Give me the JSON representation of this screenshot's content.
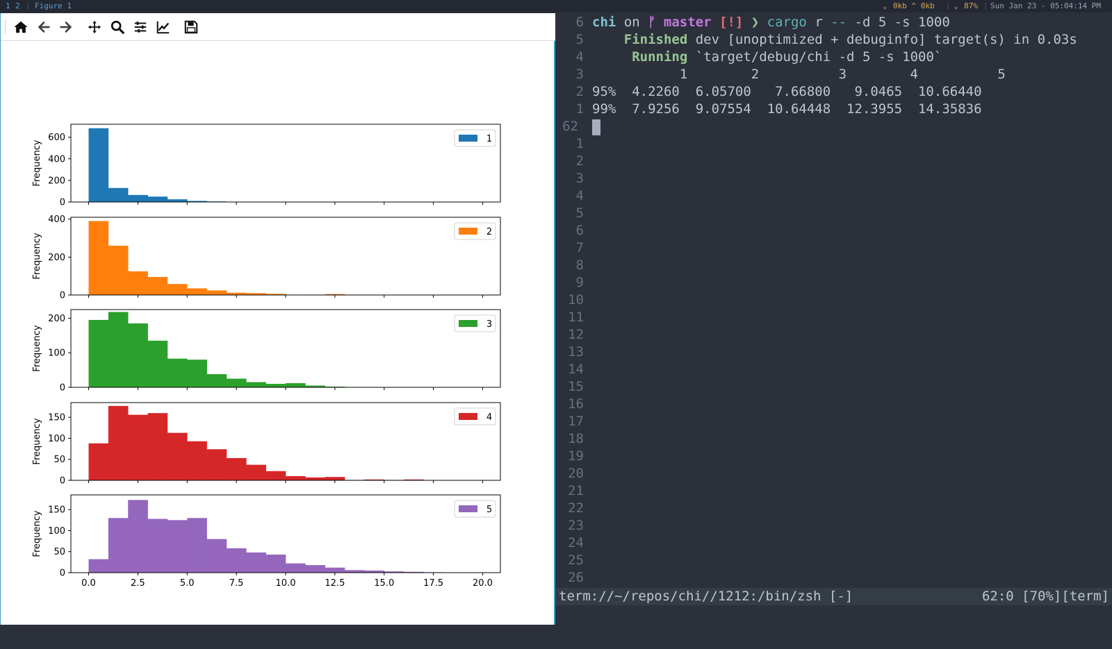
{
  "topbar": {
    "workspaces": [
      "1",
      "2"
    ],
    "window_title": "Figure 1",
    "net": "0kb ^ 0kb",
    "battery": "87%",
    "datetime": "Sun Jan 23 - 05:04:14 PM"
  },
  "figure_window": {
    "toolbar_tools": [
      {
        "name": "home-icon",
        "tooltip": "Home"
      },
      {
        "name": "back-icon",
        "tooltip": "Back"
      },
      {
        "name": "forward-icon",
        "tooltip": "Forward"
      },
      {
        "name": "pan-icon",
        "tooltip": "Pan"
      },
      {
        "name": "zoom-icon",
        "tooltip": "Zoom"
      },
      {
        "name": "configure-subplots-icon",
        "tooltip": "Subplots"
      },
      {
        "name": "edit-axes-icon",
        "tooltip": "Customize"
      },
      {
        "name": "save-icon",
        "tooltip": "Save"
      }
    ]
  },
  "chart_data": {
    "type": "bar",
    "layout": "5 stacked histogram subplots sharing x axis",
    "ylabel": "Frequency",
    "bin_start": 0,
    "bin_width": 1,
    "xlim": [
      -0.9,
      20.9
    ],
    "xticks": [
      "0.0",
      "2.5",
      "5.0",
      "7.5",
      "10.0",
      "12.5",
      "15.0",
      "17.5",
      "20.0"
    ],
    "xtick_values": [
      0,
      2.5,
      5,
      7.5,
      10,
      12.5,
      15,
      17.5,
      20
    ],
    "legend_placement": "top-right",
    "series": [
      {
        "name": "1",
        "color": "#1f77b4",
        "ylim": [
          0,
          720
        ],
        "yticks": [
          "0",
          "200",
          "400",
          "600"
        ],
        "ytick_values": [
          0,
          200,
          400,
          600
        ],
        "values": [
          683,
          130,
          65,
          50,
          25,
          10,
          5,
          3,
          2,
          1,
          0,
          0,
          0,
          0,
          0,
          0,
          0,
          0,
          0,
          0
        ]
      },
      {
        "name": "2",
        "color": "#ff7f0e",
        "ylim": [
          0,
          410
        ],
        "yticks": [
          "0",
          "200",
          "400"
        ],
        "ytick_values": [
          0,
          200,
          400
        ],
        "values": [
          390,
          260,
          125,
          95,
          58,
          35,
          24,
          12,
          10,
          6,
          2,
          1,
          5,
          1,
          0,
          0,
          0,
          0,
          0,
          0
        ]
      },
      {
        "name": "3",
        "color": "#2ca02c",
        "ylim": [
          0,
          225
        ],
        "yticks": [
          "0",
          "100",
          "200"
        ],
        "ytick_values": [
          0,
          100,
          200
        ],
        "values": [
          195,
          218,
          185,
          135,
          83,
          80,
          38,
          25,
          15,
          10,
          12,
          5,
          2,
          0,
          0,
          0,
          0,
          0,
          0,
          0
        ]
      },
      {
        "name": "4",
        "color": "#d62728",
        "ylim": [
          0,
          185
        ],
        "yticks": [
          "0",
          "50",
          "100",
          "150"
        ],
        "ytick_values": [
          0,
          50,
          100,
          150
        ],
        "values": [
          88,
          177,
          156,
          160,
          113,
          93,
          74,
          53,
          37,
          22,
          10,
          7,
          8,
          1,
          2,
          1,
          2,
          0,
          0,
          0
        ]
      },
      {
        "name": "5",
        "color": "#9467bd",
        "ylim": [
          0,
          185
        ],
        "yticks": [
          "0",
          "50",
          "100",
          "150"
        ],
        "ytick_values": [
          0,
          50,
          100,
          150
        ],
        "values": [
          32,
          130,
          173,
          128,
          125,
          130,
          80,
          58,
          48,
          43,
          22,
          18,
          12,
          6,
          5,
          3,
          2,
          1,
          0,
          0
        ]
      }
    ]
  },
  "terminal": {
    "lines": [
      {
        "num": "6",
        "parts": [
          [
            "c-cyan",
            "chi"
          ],
          [
            "c-white",
            " on "
          ],
          [
            "c-purple",
            "ᚠ master "
          ],
          [
            "c-red",
            "[!]"
          ],
          [
            "c-green",
            " ❯ "
          ],
          [
            "c-teal",
            "cargo "
          ],
          [
            "c-white",
            "r "
          ],
          [
            "c-teal",
            "-- "
          ],
          [
            "c-white",
            "-d 5 -s 1000"
          ]
        ]
      },
      {
        "num": "5",
        "parts": [
          [
            "c-green",
            "    Finished"
          ],
          [
            "c-white",
            " dev [unoptimized + debuginfo] target(s) in 0.03s"
          ]
        ]
      },
      {
        "num": "4",
        "parts": [
          [
            "c-green",
            "     Running"
          ],
          [
            "c-white",
            " `target/debug/chi -d 5 -s 1000`"
          ]
        ]
      },
      {
        "num": "3",
        "parts": [
          [
            "c-white",
            "           1        2          3        4          5"
          ]
        ]
      },
      {
        "num": "2",
        "parts": [
          [
            "c-white",
            "95%  4.2260  6.05700   7.66800   9.0465  10.66440"
          ]
        ]
      },
      {
        "num": "1",
        "parts": [
          [
            "c-white",
            "99%  7.9256  9.07554  10.64448  12.3955  14.35836"
          ]
        ]
      },
      {
        "num": "62",
        "parts": []
      },
      {
        "num": "1",
        "parts": []
      },
      {
        "num": "2",
        "parts": []
      },
      {
        "num": "3",
        "parts": []
      },
      {
        "num": "4",
        "parts": []
      },
      {
        "num": "5",
        "parts": []
      },
      {
        "num": "6",
        "parts": []
      },
      {
        "num": "7",
        "parts": []
      },
      {
        "num": "8",
        "parts": []
      },
      {
        "num": "9",
        "parts": []
      },
      {
        "num": "10",
        "parts": []
      },
      {
        "num": "11",
        "parts": []
      },
      {
        "num": "12",
        "parts": []
      },
      {
        "num": "13",
        "parts": []
      },
      {
        "num": "14",
        "parts": []
      },
      {
        "num": "15",
        "parts": []
      },
      {
        "num": "16",
        "parts": []
      },
      {
        "num": "17",
        "parts": []
      },
      {
        "num": "18",
        "parts": []
      },
      {
        "num": "19",
        "parts": []
      },
      {
        "num": "20",
        "parts": []
      },
      {
        "num": "21",
        "parts": []
      },
      {
        "num": "22",
        "parts": []
      },
      {
        "num": "23",
        "parts": []
      },
      {
        "num": "24",
        "parts": []
      },
      {
        "num": "25",
        "parts": []
      },
      {
        "num": "26",
        "parts": []
      }
    ],
    "status_left": "term://~/repos/chi//1212:/bin/zsh [-]",
    "status_right": "62:0 [70%][term]"
  }
}
